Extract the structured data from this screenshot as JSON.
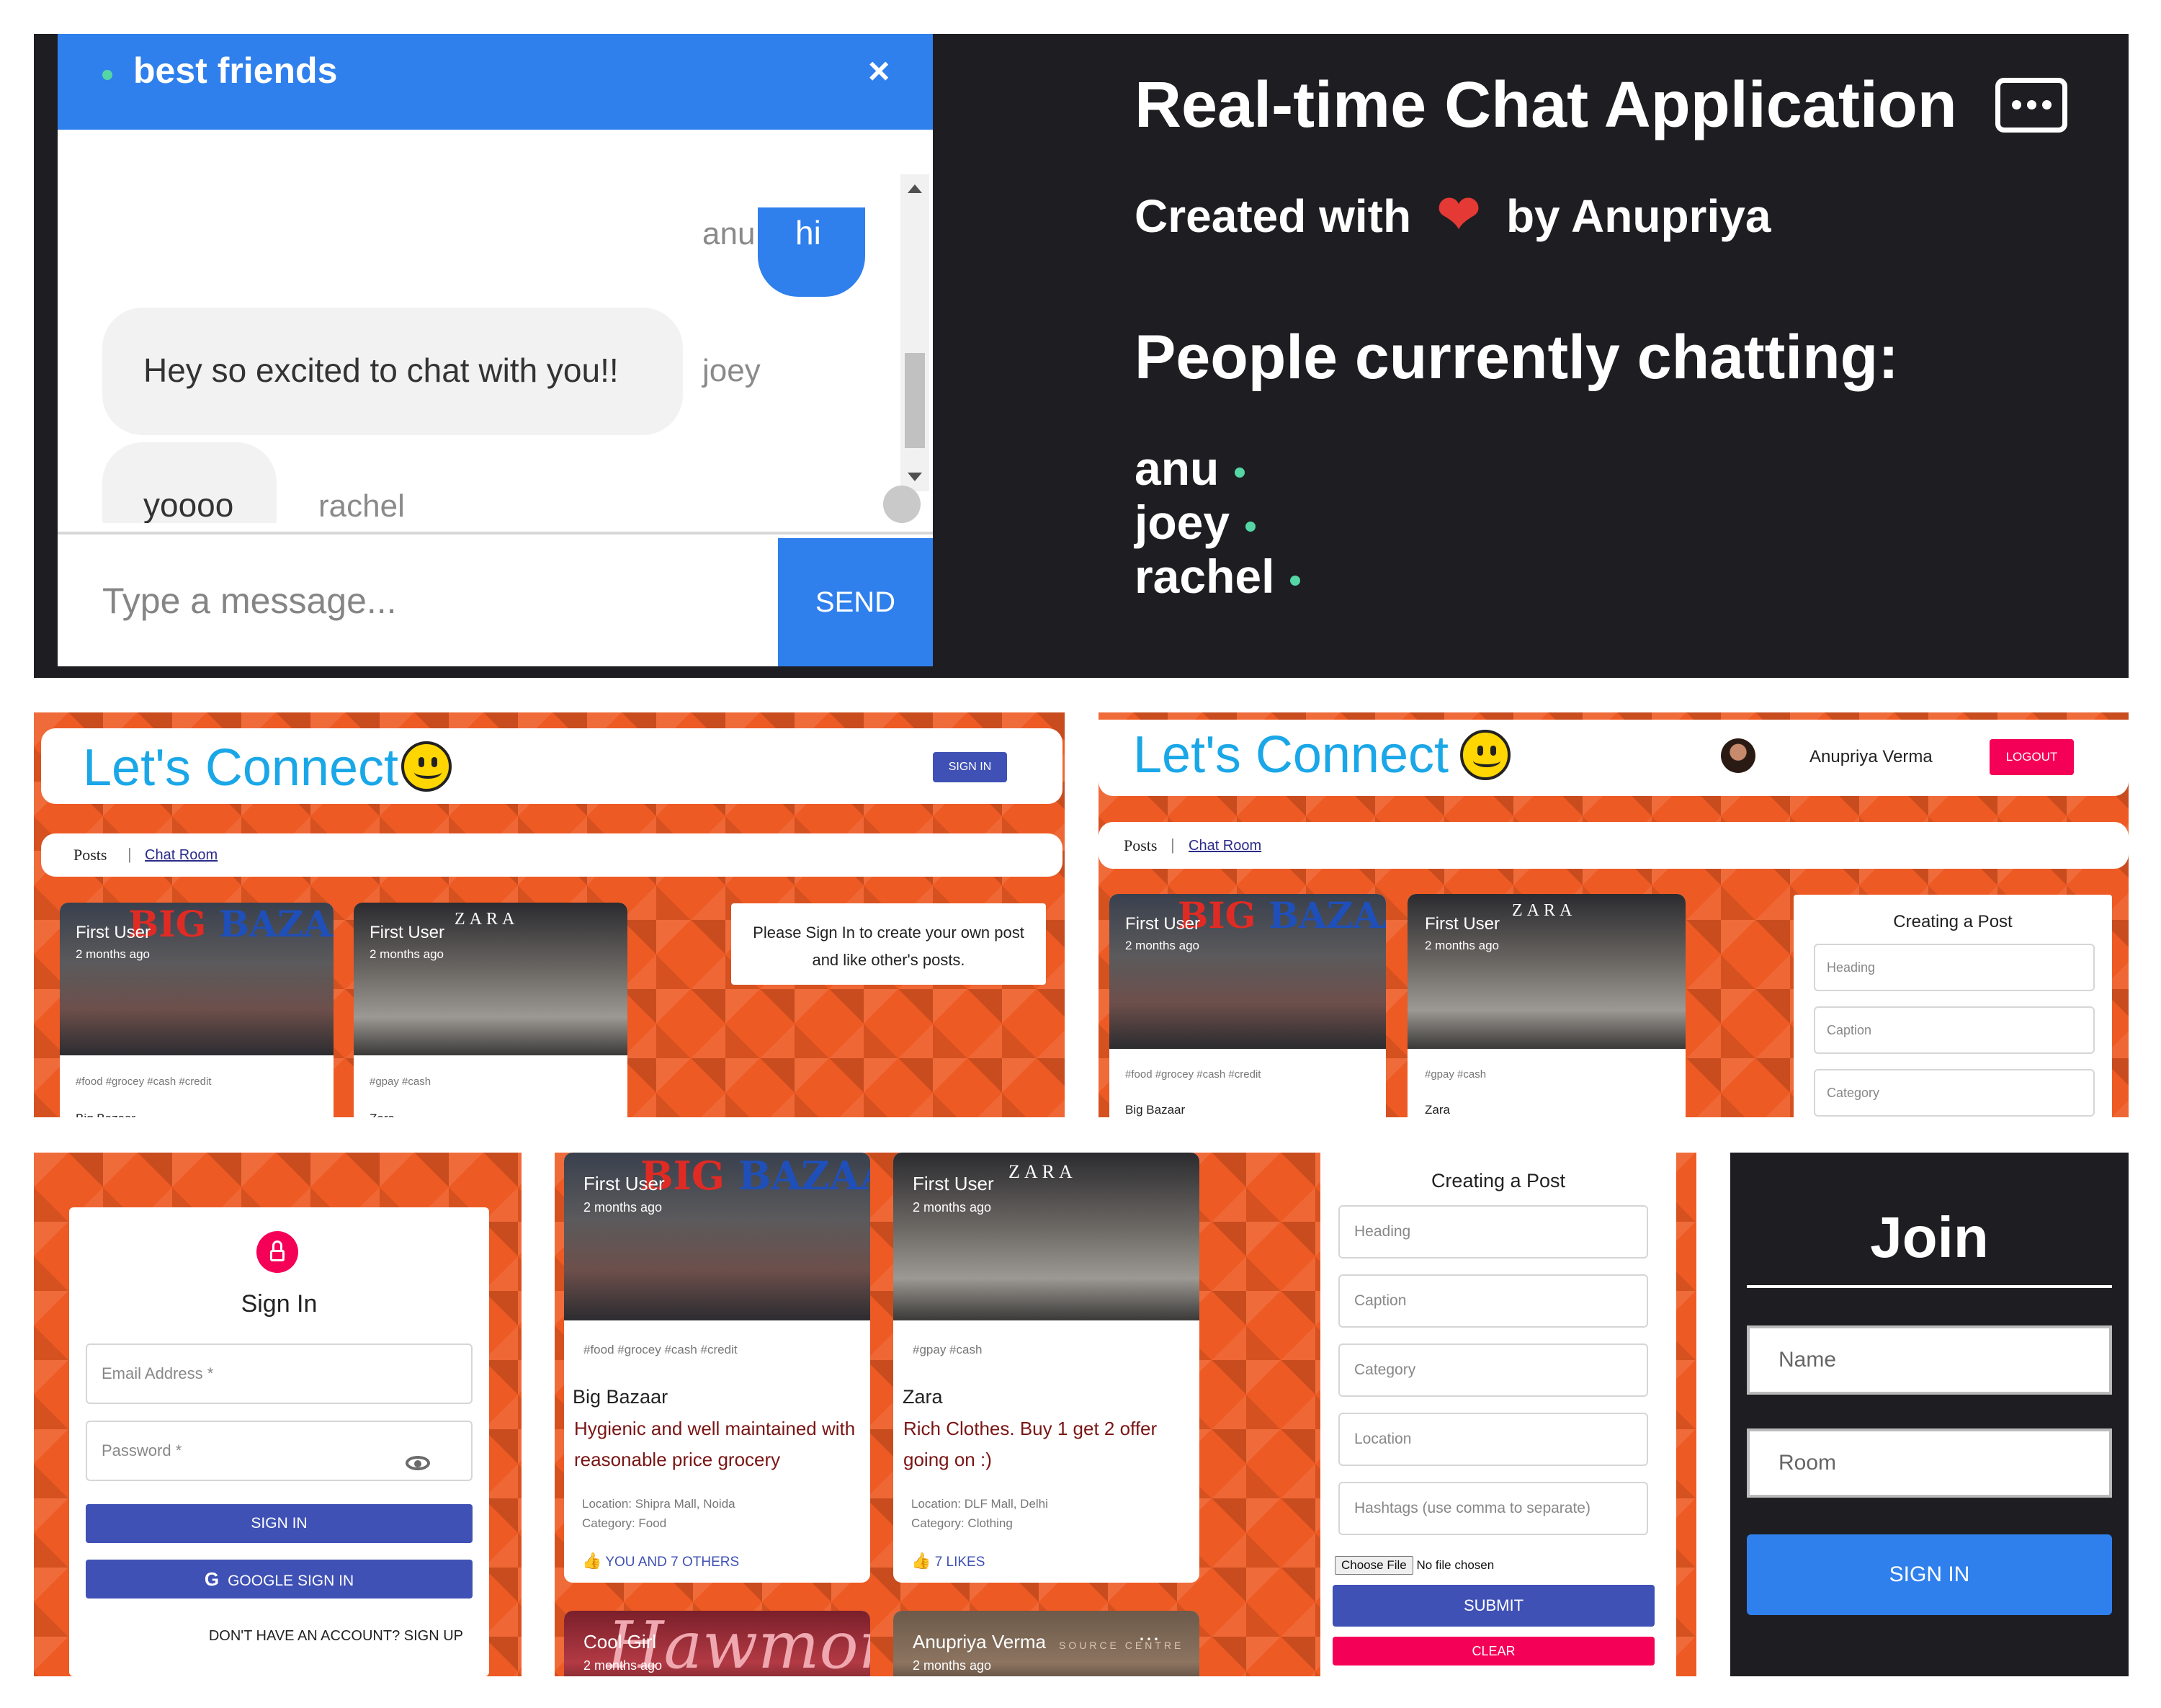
{
  "chat_panel": {
    "room_name": "best friends",
    "close_icon": "×",
    "messages": [
      {
        "user": "anu",
        "text": "hi",
        "mine": true
      },
      {
        "user": "joey",
        "text": "Hey so excited to chat with you!!",
        "mine": false
      },
      {
        "user": "rachel",
        "text": "yoooo",
        "mine": false
      }
    ],
    "input_placeholder": "Type a message...",
    "send_label": "SEND",
    "header_color": "#2f80ed",
    "online_color": "#55d6a5"
  },
  "info_panel": {
    "title": "Real-time Chat Application",
    "credit_prefix": "Created with",
    "heart": "❤",
    "credit_suffix": "by Anupriya",
    "people_title": "People currently chatting:",
    "people": [
      "anu",
      "joey",
      "rachel"
    ]
  },
  "brand": {
    "name": "Let's Connect",
    "color": "#1aa7e8",
    "icon": "smiley-face-icon"
  },
  "nav": {
    "posts": "Posts",
    "separator": "|",
    "chat_room": "Chat Room"
  },
  "landing_view": {
    "sign_in_label": "SIGN IN",
    "notice": "Please Sign In to create your own post and like other's posts."
  },
  "logged_in_view": {
    "user_name": "Anupriya Verma",
    "logout_label": "LOGOUT"
  },
  "posts": [
    {
      "user": "First User",
      "time": "2 months ago",
      "logo": {
        "part1": "BIG",
        "part2": "BAZAAR"
      },
      "tags": "#food #grocey #cash #credit",
      "title": "Big Bazaar",
      "title_cropped": "Big Bazaar",
      "description": "Hygienic and well maintained with reasonable price grocery",
      "location": "Location: Shipra Mall, Noida",
      "category": "Category: Food",
      "likes": "YOU AND 7 OTHERS"
    },
    {
      "user": "First User",
      "time": "2 months ago",
      "logo": {
        "part1": "ZARA",
        "part2": ""
      },
      "tags": "#gpay #cash",
      "title": "Zara",
      "title_cropped": "Zara",
      "description": "Rich Clothes. Buy 1 get 2 offer going on :)",
      "location": "Location: DLF Mall, Delhi",
      "category": "Category: Clothing",
      "likes": "7 LIKES"
    },
    {
      "user": "Cool Girl",
      "time": "2 months ago",
      "logo": {
        "part1": "Hawmor",
        "part2": ""
      }
    },
    {
      "user": "Anupriya Verma",
      "time": "2 months ago",
      "more_icon": "⋯",
      "logo": {
        "part1": "SOURCE CENTRE",
        "part2": ""
      }
    }
  ],
  "create_post_form": {
    "title": "Creating a Post",
    "heading_placeholder": "Heading",
    "caption_placeholder": "Caption",
    "category_placeholder": "Category",
    "location_placeholder": "Location",
    "hashtags_placeholder": "Hashtags (use comma to separate)",
    "choose_file_label": "Choose File",
    "no_file_label": "No file chosen",
    "submit_label": "SUBMIT",
    "clear_label": "CLEAR"
  },
  "sign_in_form": {
    "title": "Sign In",
    "email_placeholder": "Email Address *",
    "password_placeholder": "Password *",
    "sign_in_label": "SIGN IN",
    "google_label": "GOOGLE SIGN IN",
    "google_icon": "G",
    "signup_text": "DON'T HAVE AN ACCOUNT? SIGN UP"
  },
  "join_form": {
    "title": "Join",
    "name_placeholder": "Name",
    "room_placeholder": "Room",
    "sign_in_label": "SIGN IN"
  },
  "colors": {
    "accent_blue": "#2f80ed",
    "primary_indigo": "#3f51b5",
    "secondary_pink": "#f50057",
    "wall_orange": "#ee5a24",
    "dark_bg": "#1e1e22"
  }
}
